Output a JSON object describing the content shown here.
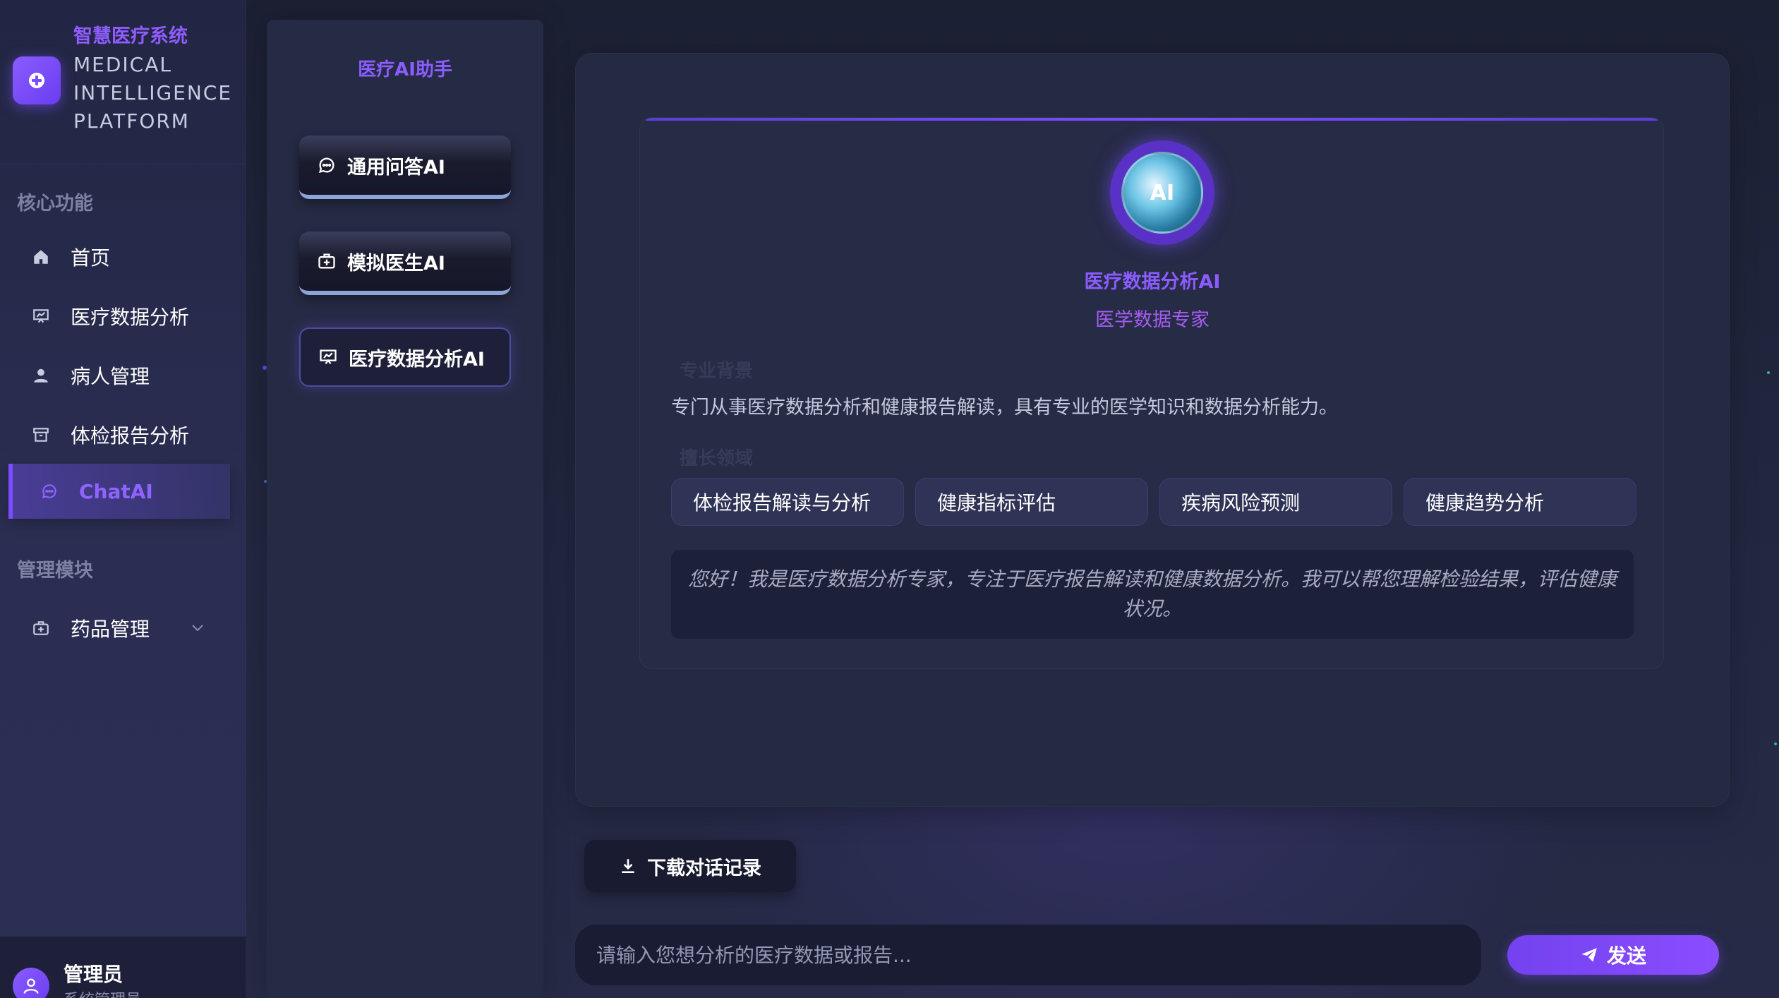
{
  "brand": {
    "name_cn": "智慧医疗系统",
    "name_en_lines": [
      "MEDICAL",
      "INTELLIGENCE",
      "PLATFORM"
    ]
  },
  "sidebar": {
    "sections": [
      {
        "title": "核心功能",
        "items": [
          {
            "label": "首页",
            "icon": "home-icon"
          },
          {
            "label": "医疗数据分析",
            "icon": "presentation-chart-icon"
          },
          {
            "label": "病人管理",
            "icon": "user-icon"
          },
          {
            "label": "体检报告分析",
            "icon": "archive-box-icon"
          },
          {
            "label": "ChatAI",
            "icon": "chat-bubble-icon",
            "active": true
          }
        ]
      },
      {
        "title": "管理模块",
        "items": [
          {
            "label": "药品管理",
            "icon": "medical-kit-icon",
            "expandable": true
          }
        ]
      }
    ]
  },
  "user": {
    "name": "管理员",
    "role": "系统管理员"
  },
  "assistant_panel": {
    "title": "医疗AI助手",
    "buttons": [
      {
        "label": "通用问答AI",
        "icon": "chat-bubble-icon"
      },
      {
        "label": "模拟医生AI",
        "icon": "medical-kit-icon"
      },
      {
        "label": "医疗数据分析AI",
        "icon": "presentation-chart-icon",
        "active": true
      }
    ]
  },
  "agent": {
    "name": "医疗数据分析AI",
    "subtitle": "医学数据专家",
    "avatar_text": "AI",
    "background_label": "专业背景",
    "description": "专门从事医疗数据分析和健康报告解读，具有专业的医学知识和数据分析能力。",
    "expertise_label": "擅长领域",
    "tags": [
      "体检报告解读与分析",
      "健康指标评估",
      "疾病风险预测",
      "健康趋势分析"
    ],
    "greeting": "您好！我是医疗数据分析专家，专注于医疗报告解读和健康数据分析。我可以帮您理解检验结果，评估健康状况。"
  },
  "actions": {
    "download_label": "下载对话记录",
    "input_placeholder": "请输入您想分析的医疗数据或报告...",
    "send_label": "发送"
  },
  "colors": {
    "accent": "#7b4dff",
    "accent_text": "#8b5cff",
    "background": "#1e2136",
    "panel": "#252a43"
  }
}
